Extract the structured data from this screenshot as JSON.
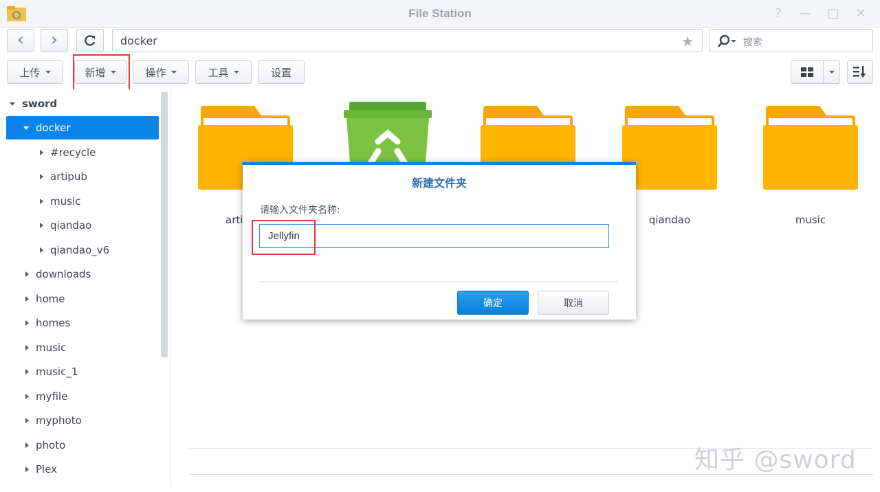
{
  "window": {
    "title": "File Station",
    "help_glyph": "?",
    "minimize_glyph": "—",
    "maximize_glyph": "□",
    "close_glyph": "✕"
  },
  "nav": {
    "back_glyph": "‹",
    "forward_glyph": "›",
    "refresh_glyph": "C",
    "path": "docker",
    "favorite_glyph": "★"
  },
  "search": {
    "placeholder": "搜索"
  },
  "toolbar": {
    "upload_label": "上传",
    "create_label": "新增",
    "action_label": "操作",
    "tools_label": "工具",
    "settings_label": "设置"
  },
  "sidebar": {
    "root": "sword",
    "items": [
      {
        "label": "docker",
        "level": 1,
        "expanded": true,
        "selected": true
      },
      {
        "label": "#recycle",
        "level": 2
      },
      {
        "label": "artipub",
        "level": 2
      },
      {
        "label": "music",
        "level": 2
      },
      {
        "label": "qiandao",
        "level": 2
      },
      {
        "label": "qiandao_v6",
        "level": 2
      },
      {
        "label": "downloads",
        "level": 1
      },
      {
        "label": "home",
        "level": 1
      },
      {
        "label": "homes",
        "level": 1
      },
      {
        "label": "music",
        "level": 1
      },
      {
        "label": "music_1",
        "level": 1
      },
      {
        "label": "myfile",
        "level": 1
      },
      {
        "label": "myphoto",
        "level": 1
      },
      {
        "label": "photo",
        "level": 1
      },
      {
        "label": "Plex",
        "level": 1
      }
    ]
  },
  "files": [
    {
      "label": "arti",
      "icon": "folder-icon"
    },
    {
      "label": "",
      "icon": "recycle-bin-icon"
    },
    {
      "label": "",
      "icon": "folder-icon"
    },
    {
      "label": "qiandao",
      "icon": "folder-icon"
    },
    {
      "label": "music",
      "icon": "folder-icon"
    }
  ],
  "dialog": {
    "title": "新建文件夹",
    "prompt": "请输入文件夹名称:",
    "input_value": "Jellyfin",
    "ok_label": "确定",
    "cancel_label": "取消"
  },
  "watermark": "知乎 @sword",
  "colors": {
    "accent": "#0a84e8",
    "folder": "#ffb000",
    "recycle": "#7cc242",
    "highlight": "#e0393b"
  }
}
